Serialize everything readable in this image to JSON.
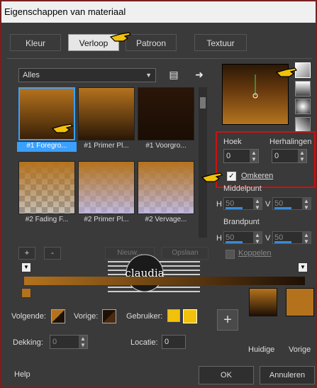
{
  "title": "Eigenschappen van materiaal",
  "tabs": [
    "Kleur",
    "Verloop",
    "Patroon",
    "Textuur"
  ],
  "category_select": "Alles",
  "thumbnails": [
    {
      "label": "#1 Foregro...",
      "selected": true
    },
    {
      "label": "#1 Primer Pl..."
    },
    {
      "label": "#1 Voorgro..."
    },
    {
      "label": "#2 Fading F..."
    },
    {
      "label": "#2 Primer Pl..."
    },
    {
      "label": "#2 Vervage..."
    }
  ],
  "settings": {
    "hoek_label": "Hoek",
    "hoek_value": "0",
    "herhalingen_label": "Herhalingen",
    "herhalingen_value": "0",
    "omkeren_label": "Omkeren",
    "omkeren_checked": true,
    "middelpunt_label": "Middelpunt",
    "brandpunt_label": "Brandpunt",
    "h_label": "H",
    "v_label": "V",
    "middelpunt_h": "50",
    "middelpunt_v": "50",
    "brandpunt_h": "50",
    "brandpunt_v": "50",
    "koppelen_label": "Koppelen"
  },
  "edit_buttons": {
    "add": "+",
    "remove": "-",
    "new": "Nieuw...",
    "save": "Opslaan"
  },
  "watermark_text": "claudia",
  "bottom": {
    "volgende": "Volgende:",
    "vorige": "Vorige:",
    "gebruiker": "Gebruiker:",
    "dekking": "Dekking:",
    "dekking_value": "0",
    "locatie": "Locatie:",
    "locatie_value": "0",
    "plus": "+",
    "huidige": "Huidige",
    "vorige_swatch": "Vorige"
  },
  "footer": {
    "help": "Help",
    "ok": "OK",
    "cancel": "Annuleren"
  },
  "colors": {
    "brown_light": "#b4721d",
    "brown_dark": "#1f1006",
    "accent_blue": "#3ba0ff",
    "highlight_red": "#d01010",
    "yellow": "#f2c10a"
  }
}
